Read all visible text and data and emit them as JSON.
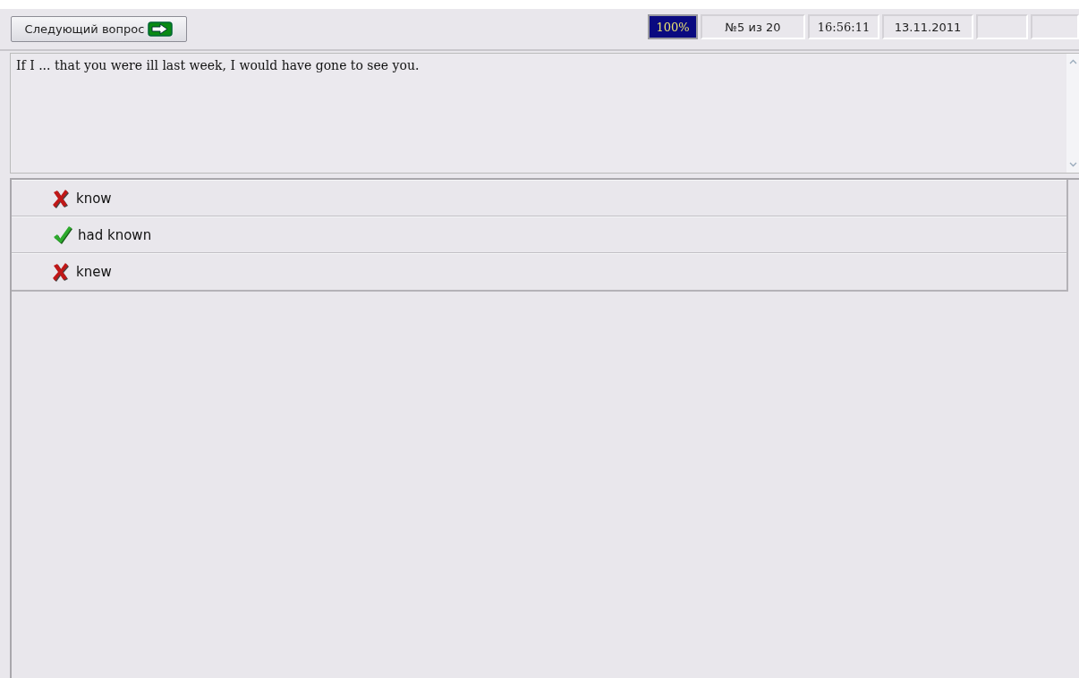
{
  "toolbar": {
    "next_button": "Следующий вопрос",
    "status": [
      {
        "text": "100%",
        "highlighted": true
      },
      {
        "text": "№5 из 20",
        "highlighted": false
      },
      {
        "text": "16:56:11",
        "highlighted": false
      },
      {
        "text": "13.11.2011",
        "highlighted": false
      }
    ]
  },
  "question": "If I ... that you were ill last week, I would have gone to see you.",
  "answers": [
    {
      "text": "know",
      "correct": false
    },
    {
      "text": "had known",
      "correct": true
    },
    {
      "text": "knew",
      "correct": false
    }
  ]
}
